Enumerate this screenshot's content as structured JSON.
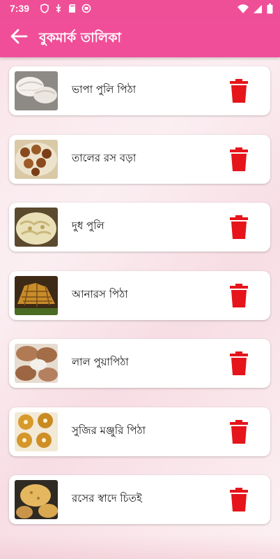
{
  "status_bar": {
    "time": "7:39",
    "left_icons": [
      "shield-icon",
      "usb-icon",
      "sd-card-icon",
      "record-icon"
    ],
    "right_icons": [
      "wifi-icon",
      "signal-icon",
      "battery-icon"
    ]
  },
  "app_bar": {
    "title": "বুকমার্ক তালিকা",
    "back_icon": "arrow-left-icon",
    "background": "#f04e98"
  },
  "items": [
    {
      "label": "ভাপা পুলি পিঠা"
    },
    {
      "label": "তালের রস বড়া"
    },
    {
      "label": "দুধ পুলি"
    },
    {
      "label": "আনারস পিঠা"
    },
    {
      "label": "লাল পুয়াপিঠা"
    },
    {
      "label": "সুজির মঞ্জুরি পিঠা"
    },
    {
      "label": "রসের স্বাদে চিতই"
    }
  ],
  "delete_icon": "trash-icon",
  "colors": {
    "accent": "#f04e98",
    "delete": "#e5151b"
  }
}
